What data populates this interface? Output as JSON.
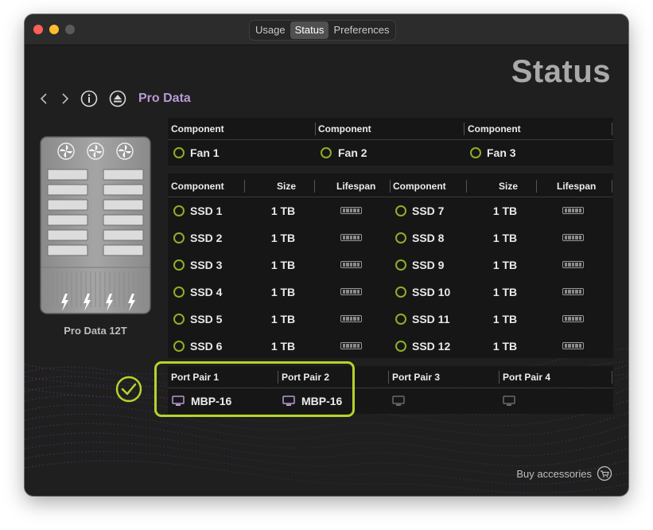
{
  "tabs": [
    {
      "label": "Usage",
      "active": false
    },
    {
      "label": "Status",
      "active": true
    },
    {
      "label": "Preferences",
      "active": false
    }
  ],
  "page_title": "Status",
  "nav": {
    "back_icon": "chevron-left-icon",
    "forward_icon": "chevron-right-icon",
    "info_icon": "info-icon",
    "eject_icon": "eject-icon",
    "device_name": "Pro Data"
  },
  "device": {
    "caption": "Pro Data 12T",
    "fan_icon": "fan-icon",
    "drive_icon": "drive-slot-icon",
    "thunderbolt_icon": "thunderbolt-icon"
  },
  "fans": {
    "headers": [
      "Component",
      "Component",
      "Component"
    ],
    "items": [
      "Fan 1",
      "Fan 2",
      "Fan 3"
    ]
  },
  "ssd": {
    "headers": [
      "Component",
      "Size",
      "Lifespan",
      "Component",
      "Size",
      "Lifespan"
    ],
    "left": [
      {
        "name": "SSD 1",
        "size": "1 TB"
      },
      {
        "name": "SSD 2",
        "size": "1 TB"
      },
      {
        "name": "SSD 3",
        "size": "1 TB"
      },
      {
        "name": "SSD 4",
        "size": "1 TB"
      },
      {
        "name": "SSD 5",
        "size": "1 TB"
      },
      {
        "name": "SSD 6",
        "size": "1 TB"
      }
    ],
    "right": [
      {
        "name": "SSD 7",
        "size": "1 TB"
      },
      {
        "name": "SSD 8",
        "size": "1 TB"
      },
      {
        "name": "SSD 9",
        "size": "1 TB"
      },
      {
        "name": "SSD 10",
        "size": "1 TB"
      },
      {
        "name": "SSD 11",
        "size": "1 TB"
      },
      {
        "name": "SSD 12",
        "size": "1 TB"
      }
    ],
    "lifespan_icon": "lifespan-bar-icon"
  },
  "ports": {
    "headers": [
      "Port Pair 1",
      "Port Pair 2",
      "Port Pair 3",
      "Port Pair 4"
    ],
    "connections": [
      "MBP-16",
      "MBP-16",
      "",
      ""
    ],
    "computer_icon": "computer-icon"
  },
  "check_icon": "checkmark-circle-icon",
  "buy_accessories": "Buy accessories",
  "cart_icon": "cart-icon",
  "colors": {
    "status_ok": "#8fae28",
    "highlight": "#b5d42a",
    "accent_purple": "#b79ad6"
  }
}
